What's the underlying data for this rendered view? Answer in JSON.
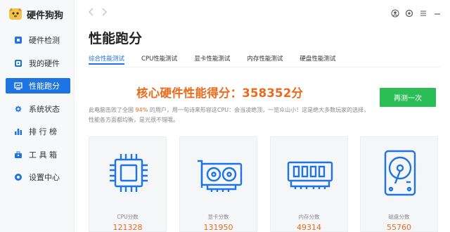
{
  "app": {
    "name": "硬件狗狗"
  },
  "sidebar": {
    "items": [
      {
        "label": "硬件检测",
        "icon": "hardware-detect-icon",
        "active": false
      },
      {
        "label": "我的硬件",
        "icon": "my-hardware-icon",
        "active": false
      },
      {
        "label": "性能跑分",
        "icon": "benchmark-icon",
        "active": true
      },
      {
        "label": "系统状态",
        "icon": "system-status-icon",
        "active": false
      },
      {
        "label": "排 行 榜",
        "icon": "ranking-icon",
        "active": false
      },
      {
        "label": "工 具 箱",
        "icon": "toolbox-icon",
        "active": false
      },
      {
        "label": "设置中心",
        "icon": "settings-icon",
        "active": false
      }
    ]
  },
  "header": {
    "title": "性能跑分"
  },
  "tabs": [
    {
      "label": "综合性能测试",
      "active": true
    },
    {
      "label": "CPU性能测试",
      "active": false
    },
    {
      "label": "显卡性能测试",
      "active": false
    },
    {
      "label": "内存性能测试",
      "active": false
    },
    {
      "label": "硬盘性能测试",
      "active": false
    }
  ],
  "score": {
    "text": "核心硬件性能得分：358352分",
    "value": 358352
  },
  "retest_label": "再测一次",
  "description": {
    "before": "此电脑击败了全国 ",
    "percent": "94%",
    "after": " 的用户，用一句诗来形容这CPU：会当凌绝顶，一览众山小！这是绝大多数玩家的选择，性能各方面都均衡，是光很不错哦。"
  },
  "cards": [
    {
      "label": "CPU分数",
      "value": "121328",
      "icon": "cpu-icon"
    },
    {
      "label": "显卡分数",
      "value": "131950",
      "icon": "gpu-icon"
    },
    {
      "label": "内存分数",
      "value": "49314",
      "icon": "ram-icon"
    },
    {
      "label": "磁盘分数",
      "value": "55760",
      "icon": "disk-icon"
    }
  ],
  "colors": {
    "accent": "#1f74e3",
    "score": "#ee6a1b",
    "button": "#2bbd56"
  }
}
